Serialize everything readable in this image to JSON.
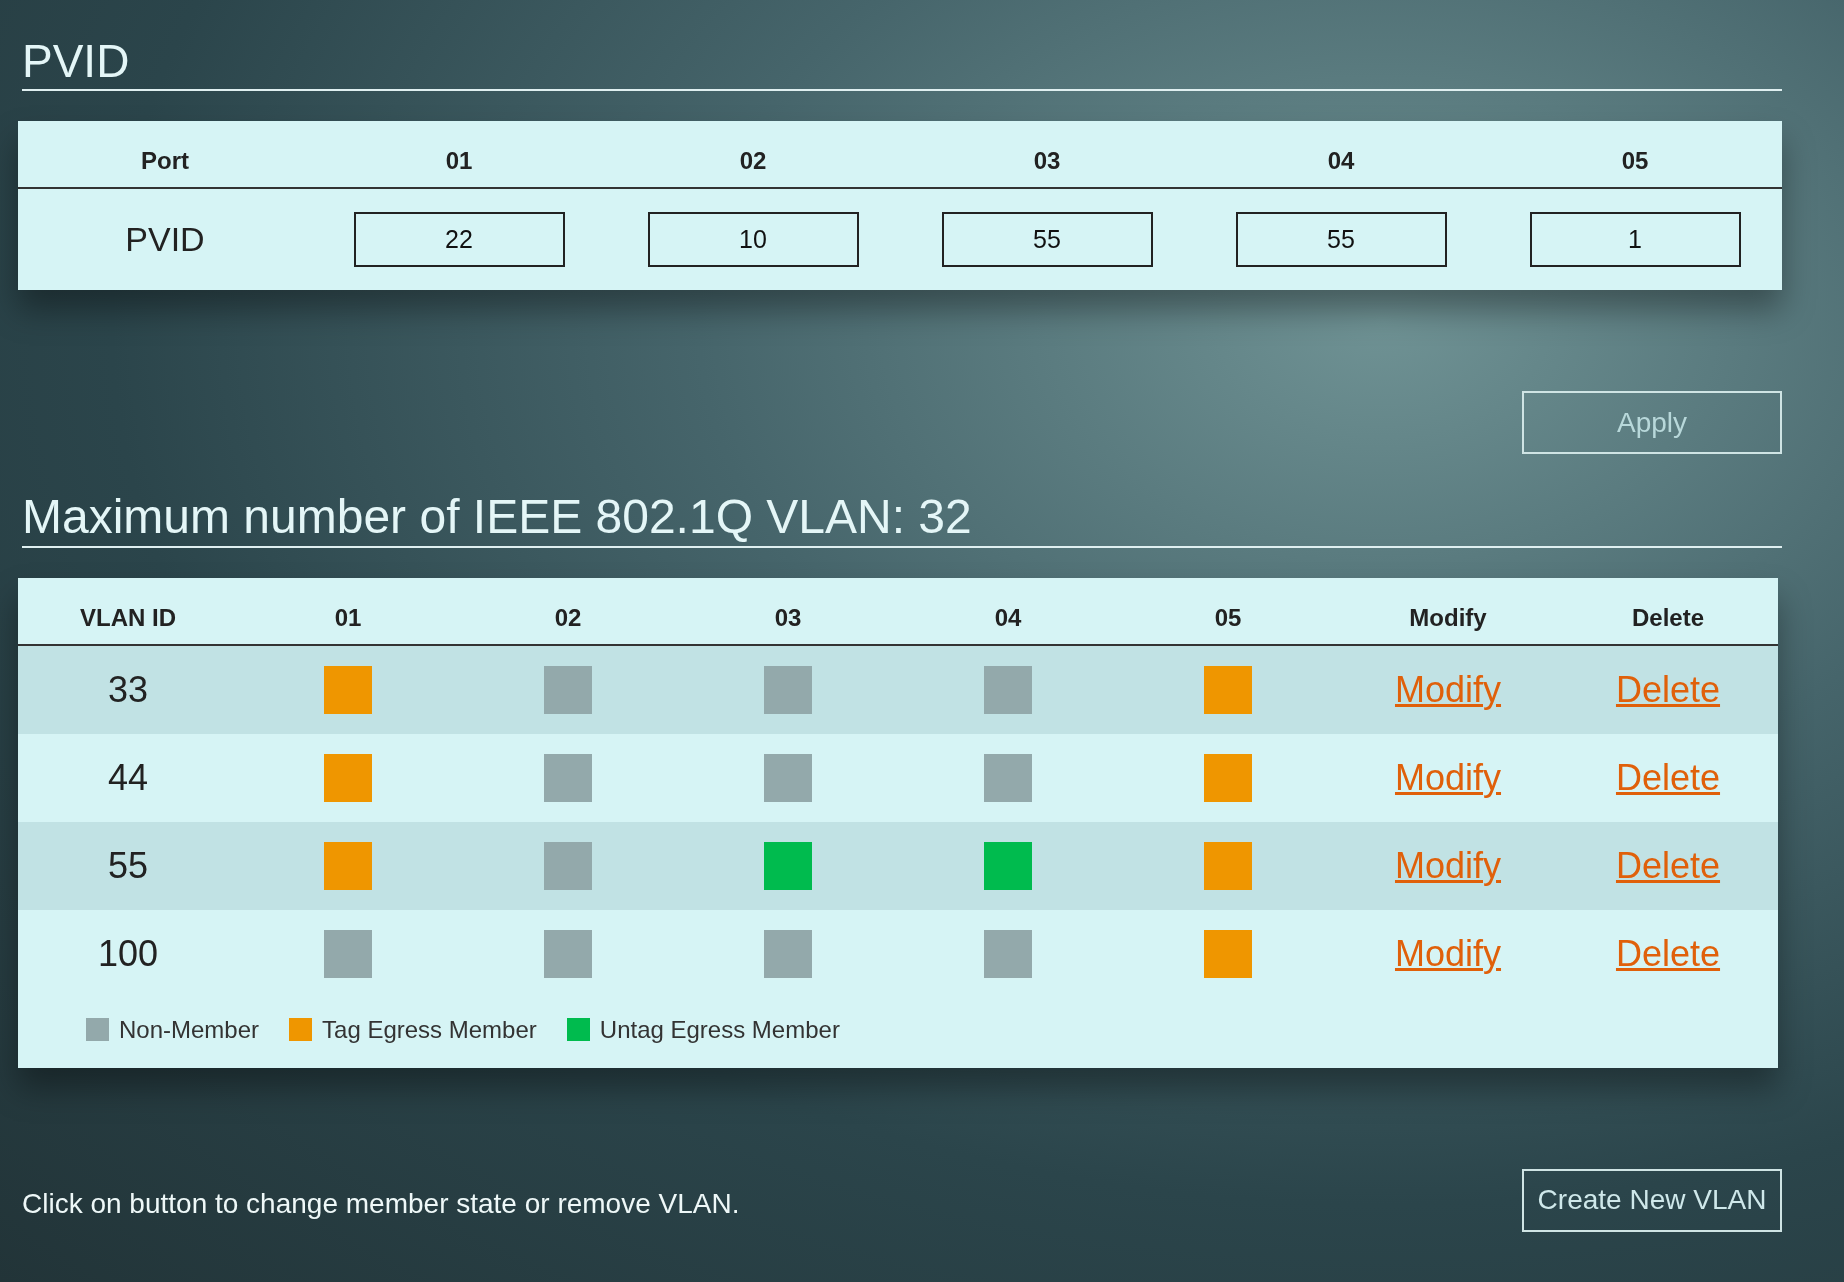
{
  "pvid_section": {
    "title": "PVID",
    "columns": [
      "Port",
      "01",
      "02",
      "03",
      "04",
      "05"
    ],
    "row_label": "PVID",
    "values": [
      "22",
      "10",
      "55",
      "55",
      "1"
    ]
  },
  "apply_button": "Apply",
  "vlan_section": {
    "title": "Maximum number of IEEE 802.1Q VLAN: 32",
    "columns": [
      "VLAN ID",
      "01",
      "02",
      "03",
      "04",
      "05",
      "Modify",
      "Delete"
    ],
    "rows": [
      {
        "id": "33",
        "ports": [
          {
            "kind": "tag"
          },
          {
            "kind": "non"
          },
          {
            "kind": "non"
          },
          {
            "kind": "non"
          },
          {
            "kind": "tag"
          }
        ],
        "modify": "Modify",
        "delete": "Delete"
      },
      {
        "id": "44",
        "ports": [
          {
            "kind": "tag"
          },
          {
            "kind": "non"
          },
          {
            "kind": "non"
          },
          {
            "kind": "non"
          },
          {
            "kind": "tag"
          }
        ],
        "modify": "Modify",
        "delete": "Delete"
      },
      {
        "id": "55",
        "ports": [
          {
            "kind": "tag"
          },
          {
            "kind": "non"
          },
          {
            "kind": "untag"
          },
          {
            "kind": "untag"
          },
          {
            "kind": "tag"
          }
        ],
        "modify": "Modify",
        "delete": "Delete"
      },
      {
        "id": "100",
        "ports": [
          {
            "kind": "non"
          },
          {
            "kind": "non"
          },
          {
            "kind": "non"
          },
          {
            "kind": "non"
          },
          {
            "kind": "tag"
          }
        ],
        "modify": "Modify",
        "delete": "Delete"
      }
    ],
    "legend": [
      {
        "kind": "non",
        "label": "Non-Member",
        "color": "#93a9ab"
      },
      {
        "kind": "tag",
        "label": "Tag Egress Member",
        "color": "#ef9600"
      },
      {
        "kind": "untag",
        "label": "Untag Egress Member",
        "color": "#00bb4e"
      }
    ]
  },
  "hint": "Click on button to change member state or remove VLAN.",
  "create_button": "Create New VLAN"
}
